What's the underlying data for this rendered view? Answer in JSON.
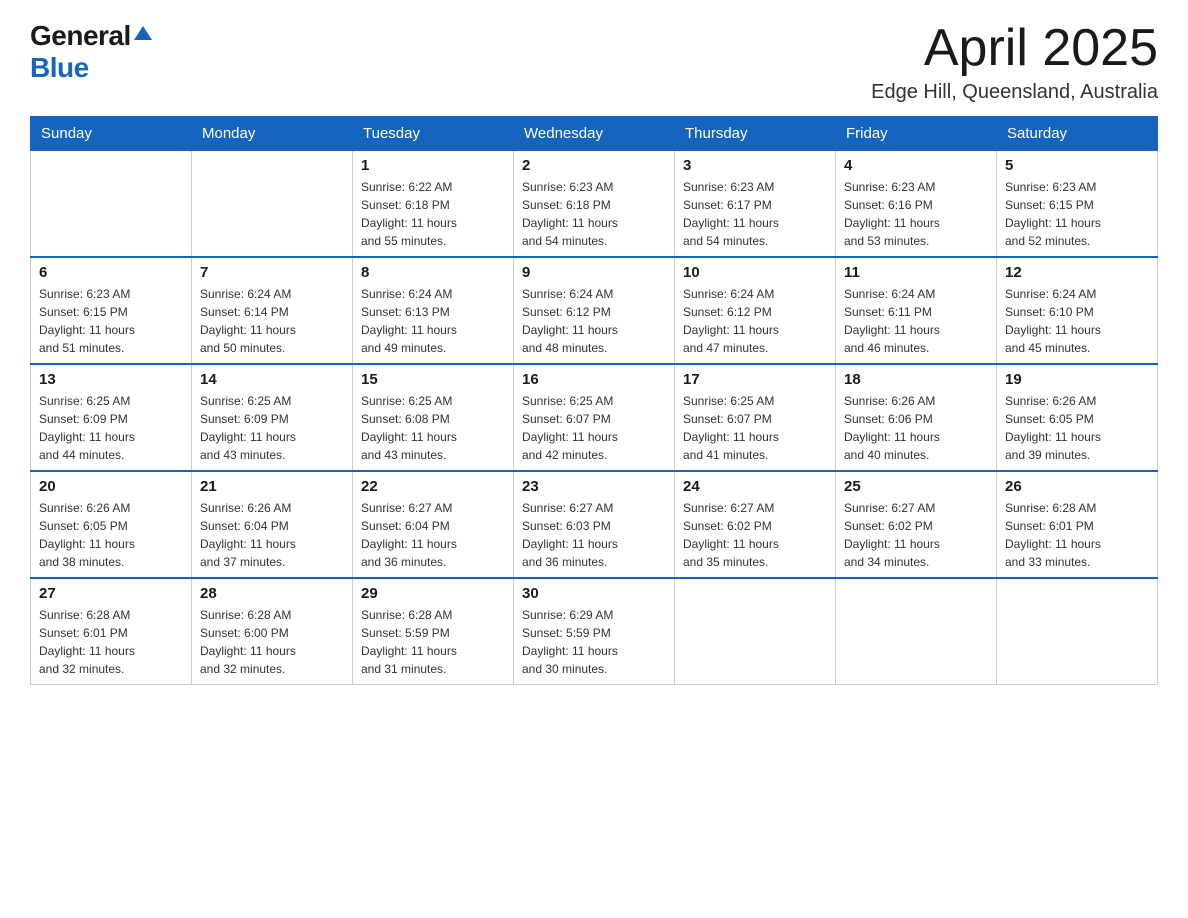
{
  "header": {
    "logo_general": "General",
    "logo_blue": "Blue",
    "month_title": "April 2025",
    "location": "Edge Hill, Queensland, Australia"
  },
  "days_of_week": [
    "Sunday",
    "Monday",
    "Tuesday",
    "Wednesday",
    "Thursday",
    "Friday",
    "Saturday"
  ],
  "weeks": [
    [
      {
        "day": "",
        "info": ""
      },
      {
        "day": "",
        "info": ""
      },
      {
        "day": "1",
        "info": "Sunrise: 6:22 AM\nSunset: 6:18 PM\nDaylight: 11 hours\nand 55 minutes."
      },
      {
        "day": "2",
        "info": "Sunrise: 6:23 AM\nSunset: 6:18 PM\nDaylight: 11 hours\nand 54 minutes."
      },
      {
        "day": "3",
        "info": "Sunrise: 6:23 AM\nSunset: 6:17 PM\nDaylight: 11 hours\nand 54 minutes."
      },
      {
        "day": "4",
        "info": "Sunrise: 6:23 AM\nSunset: 6:16 PM\nDaylight: 11 hours\nand 53 minutes."
      },
      {
        "day": "5",
        "info": "Sunrise: 6:23 AM\nSunset: 6:15 PM\nDaylight: 11 hours\nand 52 minutes."
      }
    ],
    [
      {
        "day": "6",
        "info": "Sunrise: 6:23 AM\nSunset: 6:15 PM\nDaylight: 11 hours\nand 51 minutes."
      },
      {
        "day": "7",
        "info": "Sunrise: 6:24 AM\nSunset: 6:14 PM\nDaylight: 11 hours\nand 50 minutes."
      },
      {
        "day": "8",
        "info": "Sunrise: 6:24 AM\nSunset: 6:13 PM\nDaylight: 11 hours\nand 49 minutes."
      },
      {
        "day": "9",
        "info": "Sunrise: 6:24 AM\nSunset: 6:12 PM\nDaylight: 11 hours\nand 48 minutes."
      },
      {
        "day": "10",
        "info": "Sunrise: 6:24 AM\nSunset: 6:12 PM\nDaylight: 11 hours\nand 47 minutes."
      },
      {
        "day": "11",
        "info": "Sunrise: 6:24 AM\nSunset: 6:11 PM\nDaylight: 11 hours\nand 46 minutes."
      },
      {
        "day": "12",
        "info": "Sunrise: 6:24 AM\nSunset: 6:10 PM\nDaylight: 11 hours\nand 45 minutes."
      }
    ],
    [
      {
        "day": "13",
        "info": "Sunrise: 6:25 AM\nSunset: 6:09 PM\nDaylight: 11 hours\nand 44 minutes."
      },
      {
        "day": "14",
        "info": "Sunrise: 6:25 AM\nSunset: 6:09 PM\nDaylight: 11 hours\nand 43 minutes."
      },
      {
        "day": "15",
        "info": "Sunrise: 6:25 AM\nSunset: 6:08 PM\nDaylight: 11 hours\nand 43 minutes."
      },
      {
        "day": "16",
        "info": "Sunrise: 6:25 AM\nSunset: 6:07 PM\nDaylight: 11 hours\nand 42 minutes."
      },
      {
        "day": "17",
        "info": "Sunrise: 6:25 AM\nSunset: 6:07 PM\nDaylight: 11 hours\nand 41 minutes."
      },
      {
        "day": "18",
        "info": "Sunrise: 6:26 AM\nSunset: 6:06 PM\nDaylight: 11 hours\nand 40 minutes."
      },
      {
        "day": "19",
        "info": "Sunrise: 6:26 AM\nSunset: 6:05 PM\nDaylight: 11 hours\nand 39 minutes."
      }
    ],
    [
      {
        "day": "20",
        "info": "Sunrise: 6:26 AM\nSunset: 6:05 PM\nDaylight: 11 hours\nand 38 minutes."
      },
      {
        "day": "21",
        "info": "Sunrise: 6:26 AM\nSunset: 6:04 PM\nDaylight: 11 hours\nand 37 minutes."
      },
      {
        "day": "22",
        "info": "Sunrise: 6:27 AM\nSunset: 6:04 PM\nDaylight: 11 hours\nand 36 minutes."
      },
      {
        "day": "23",
        "info": "Sunrise: 6:27 AM\nSunset: 6:03 PM\nDaylight: 11 hours\nand 36 minutes."
      },
      {
        "day": "24",
        "info": "Sunrise: 6:27 AM\nSunset: 6:02 PM\nDaylight: 11 hours\nand 35 minutes."
      },
      {
        "day": "25",
        "info": "Sunrise: 6:27 AM\nSunset: 6:02 PM\nDaylight: 11 hours\nand 34 minutes."
      },
      {
        "day": "26",
        "info": "Sunrise: 6:28 AM\nSunset: 6:01 PM\nDaylight: 11 hours\nand 33 minutes."
      }
    ],
    [
      {
        "day": "27",
        "info": "Sunrise: 6:28 AM\nSunset: 6:01 PM\nDaylight: 11 hours\nand 32 minutes."
      },
      {
        "day": "28",
        "info": "Sunrise: 6:28 AM\nSunset: 6:00 PM\nDaylight: 11 hours\nand 32 minutes."
      },
      {
        "day": "29",
        "info": "Sunrise: 6:28 AM\nSunset: 5:59 PM\nDaylight: 11 hours\nand 31 minutes."
      },
      {
        "day": "30",
        "info": "Sunrise: 6:29 AM\nSunset: 5:59 PM\nDaylight: 11 hours\nand 30 minutes."
      },
      {
        "day": "",
        "info": ""
      },
      {
        "day": "",
        "info": ""
      },
      {
        "day": "",
        "info": ""
      }
    ]
  ]
}
